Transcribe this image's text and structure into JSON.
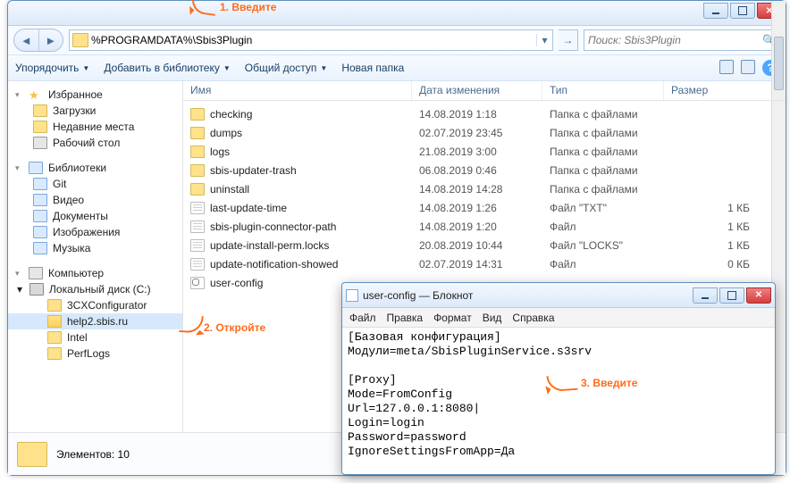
{
  "explorer": {
    "address": "%PROGRAMDATA%\\Sbis3Plugin",
    "search_placeholder": "Поиск: Sbis3Plugin",
    "toolbar": {
      "organize": "Упорядочить",
      "addlib": "Добавить в библиотеку",
      "share": "Общий доступ",
      "newfolder": "Новая папка"
    },
    "tree": {
      "fav_header": "Избранное",
      "fav": [
        "Загрузки",
        "Недавние места",
        "Рабочий стол"
      ],
      "lib_header": "Библиотеки",
      "lib": [
        "Git",
        "Видео",
        "Документы",
        "Изображения",
        "Музыка"
      ],
      "pc_header": "Компьютер",
      "drive": "Локальный диск (C:)",
      "drive_children": [
        "3CXConfigurator",
        "help2.sbis.ru",
        "Intel",
        "PerfLogs"
      ]
    },
    "columns": {
      "name": "Имя",
      "date": "Дата изменения",
      "type": "Тип",
      "size": "Размер"
    },
    "rows": [
      {
        "icon": "folder",
        "name": "checking",
        "date": "14.08.2019 1:18",
        "type": "Папка с файлами",
        "size": ""
      },
      {
        "icon": "folder",
        "name": "dumps",
        "date": "02.07.2019 23:45",
        "type": "Папка с файлами",
        "size": ""
      },
      {
        "icon": "folder",
        "name": "logs",
        "date": "21.08.2019 3:00",
        "type": "Папка с файлами",
        "size": ""
      },
      {
        "icon": "folder",
        "name": "sbis-updater-trash",
        "date": "06.08.2019 0:46",
        "type": "Папка с файлами",
        "size": ""
      },
      {
        "icon": "folder",
        "name": "uninstall",
        "date": "14.08.2019 14:28",
        "type": "Папка с файлами",
        "size": ""
      },
      {
        "icon": "file",
        "name": "last-update-time",
        "date": "14.08.2019 1:26",
        "type": "Файл \"TXT\"",
        "size": "1 КБ"
      },
      {
        "icon": "file",
        "name": "sbis-plugin-connector-path",
        "date": "14.08.2019 1:20",
        "type": "Файл",
        "size": "1 КБ"
      },
      {
        "icon": "file",
        "name": "update-install-perm.locks",
        "date": "20.08.2019 10:44",
        "type": "Файл \"LOCKS\"",
        "size": "1 КБ"
      },
      {
        "icon": "file",
        "name": "update-notification-showed",
        "date": "02.07.2019 14:31",
        "type": "Файл",
        "size": "0 КБ"
      },
      {
        "icon": "cfg",
        "name": "user-config",
        "date": "",
        "type": "",
        "size": ""
      }
    ],
    "status": "Элементов: 10"
  },
  "notepad": {
    "title": "user-config — Блокнот",
    "menu": [
      "Файл",
      "Правка",
      "Формат",
      "Вид",
      "Справка"
    ],
    "content": "[Базовая конфигурация]\nМодули=meta/SbisPluginService.s3srv\n\n[Proxy]\nMode=FromConfig\nUrl=127.0.0.1:8080|\nLogin=login\nPassword=password\nIgnoreSettingsFromApp=Да"
  },
  "annotations": {
    "a1": "1. Введите",
    "a2": "2. Откройте",
    "a3": "3. Введите"
  }
}
